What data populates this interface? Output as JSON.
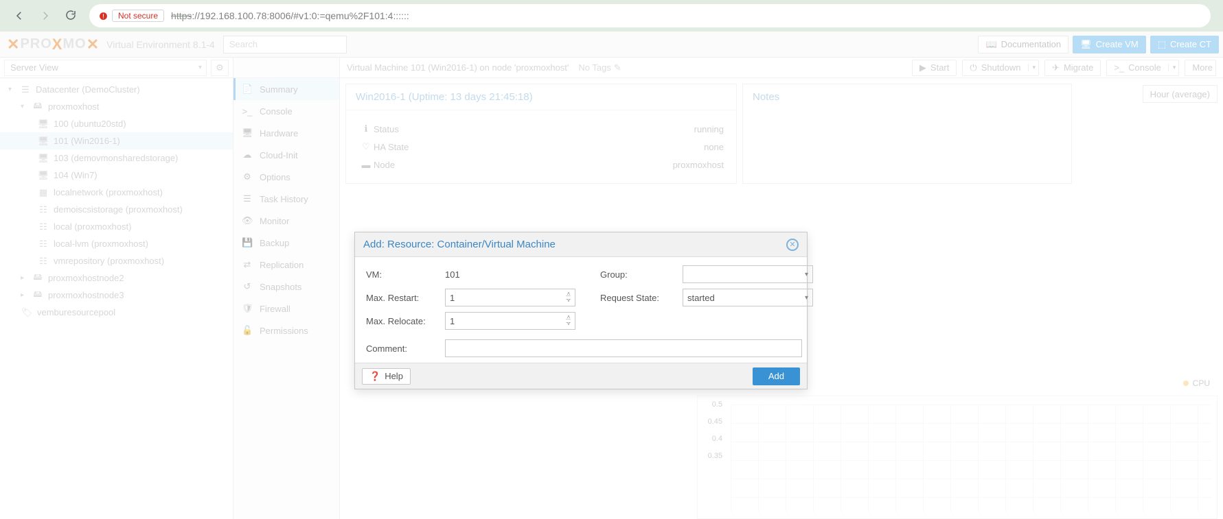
{
  "browser": {
    "not_secure": "Not secure",
    "url_https": "https",
    "url_rest": "://192.168.100.78:8006/#v1:0:=qemu%2F101:4::::::"
  },
  "header": {
    "logo": "PROXMOX",
    "subtitle": "Virtual Environment 8.1-4",
    "search_placeholder": "Search",
    "documentation": "Documentation",
    "create_vm": "Create VM",
    "create_ct": "Create CT"
  },
  "left": {
    "server_view": "Server View",
    "tree": {
      "datacenter": "Datacenter (DemoCluster)",
      "host": "proxmoxhost",
      "vm100": "100 (ubuntu20std)",
      "vm101": "101 (Win2016-1)",
      "vm103": "103 (demovmonsharedstorage)",
      "vm104": "104 (Win7)",
      "localnet": "localnetwork (proxmoxhost)",
      "iscsi": "demoiscsistorage (proxmoxhost)",
      "local": "local (proxmoxhost)",
      "locallvm": "local-lvm (proxmoxhost)",
      "vmrepo": "vmrepository (proxmoxhost)",
      "node2": "proxmoxhostnode2",
      "node3": "proxmoxhostnode3",
      "pool": "vemburesourcepool"
    }
  },
  "midnav": {
    "summary": "Summary",
    "console": "Console",
    "hardware": "Hardware",
    "cloudinit": "Cloud-Init",
    "options": "Options",
    "taskhistory": "Task History",
    "monitor": "Monitor",
    "backup": "Backup",
    "replication": "Replication",
    "snapshots": "Snapshots",
    "firewall": "Firewall",
    "permissions": "Permissions"
  },
  "content": {
    "title": "Virtual Machine 101 (Win2016-1) on node 'proxmoxhost'",
    "notags": "No Tags",
    "btn_start": "Start",
    "btn_shutdown": "Shutdown",
    "btn_migrate": "Migrate",
    "btn_console": "Console",
    "btn_more": "More",
    "time_selector": "Hour (average)",
    "panel_title": "Win2016-1 (Uptime: 13 days 21:45:18)",
    "notes_title": "Notes",
    "status_lbl": "Status",
    "status_val": "running",
    "ha_lbl": "HA State",
    "ha_val": "none",
    "node_lbl": "Node",
    "node_val": "proxmoxhost",
    "cpu_legend": "CPU"
  },
  "modal": {
    "title": "Add: Resource: Container/Virtual Machine",
    "vm_lbl": "VM:",
    "vm_val": "101",
    "maxrestart_lbl": "Max. Restart:",
    "maxrestart_val": "1",
    "maxrelocate_lbl": "Max. Relocate:",
    "maxrelocate_val": "1",
    "group_lbl": "Group:",
    "group_val": "",
    "reqstate_lbl": "Request State:",
    "reqstate_val": "started",
    "comment_lbl": "Comment:",
    "help": "Help",
    "add": "Add"
  },
  "chart_data": {
    "type": "line",
    "ylabels": [
      "0.5",
      "0.45",
      "0.4",
      "0.35"
    ],
    "series": [
      {
        "name": "CPU usage",
        "color": "#f5c96b"
      }
    ]
  }
}
